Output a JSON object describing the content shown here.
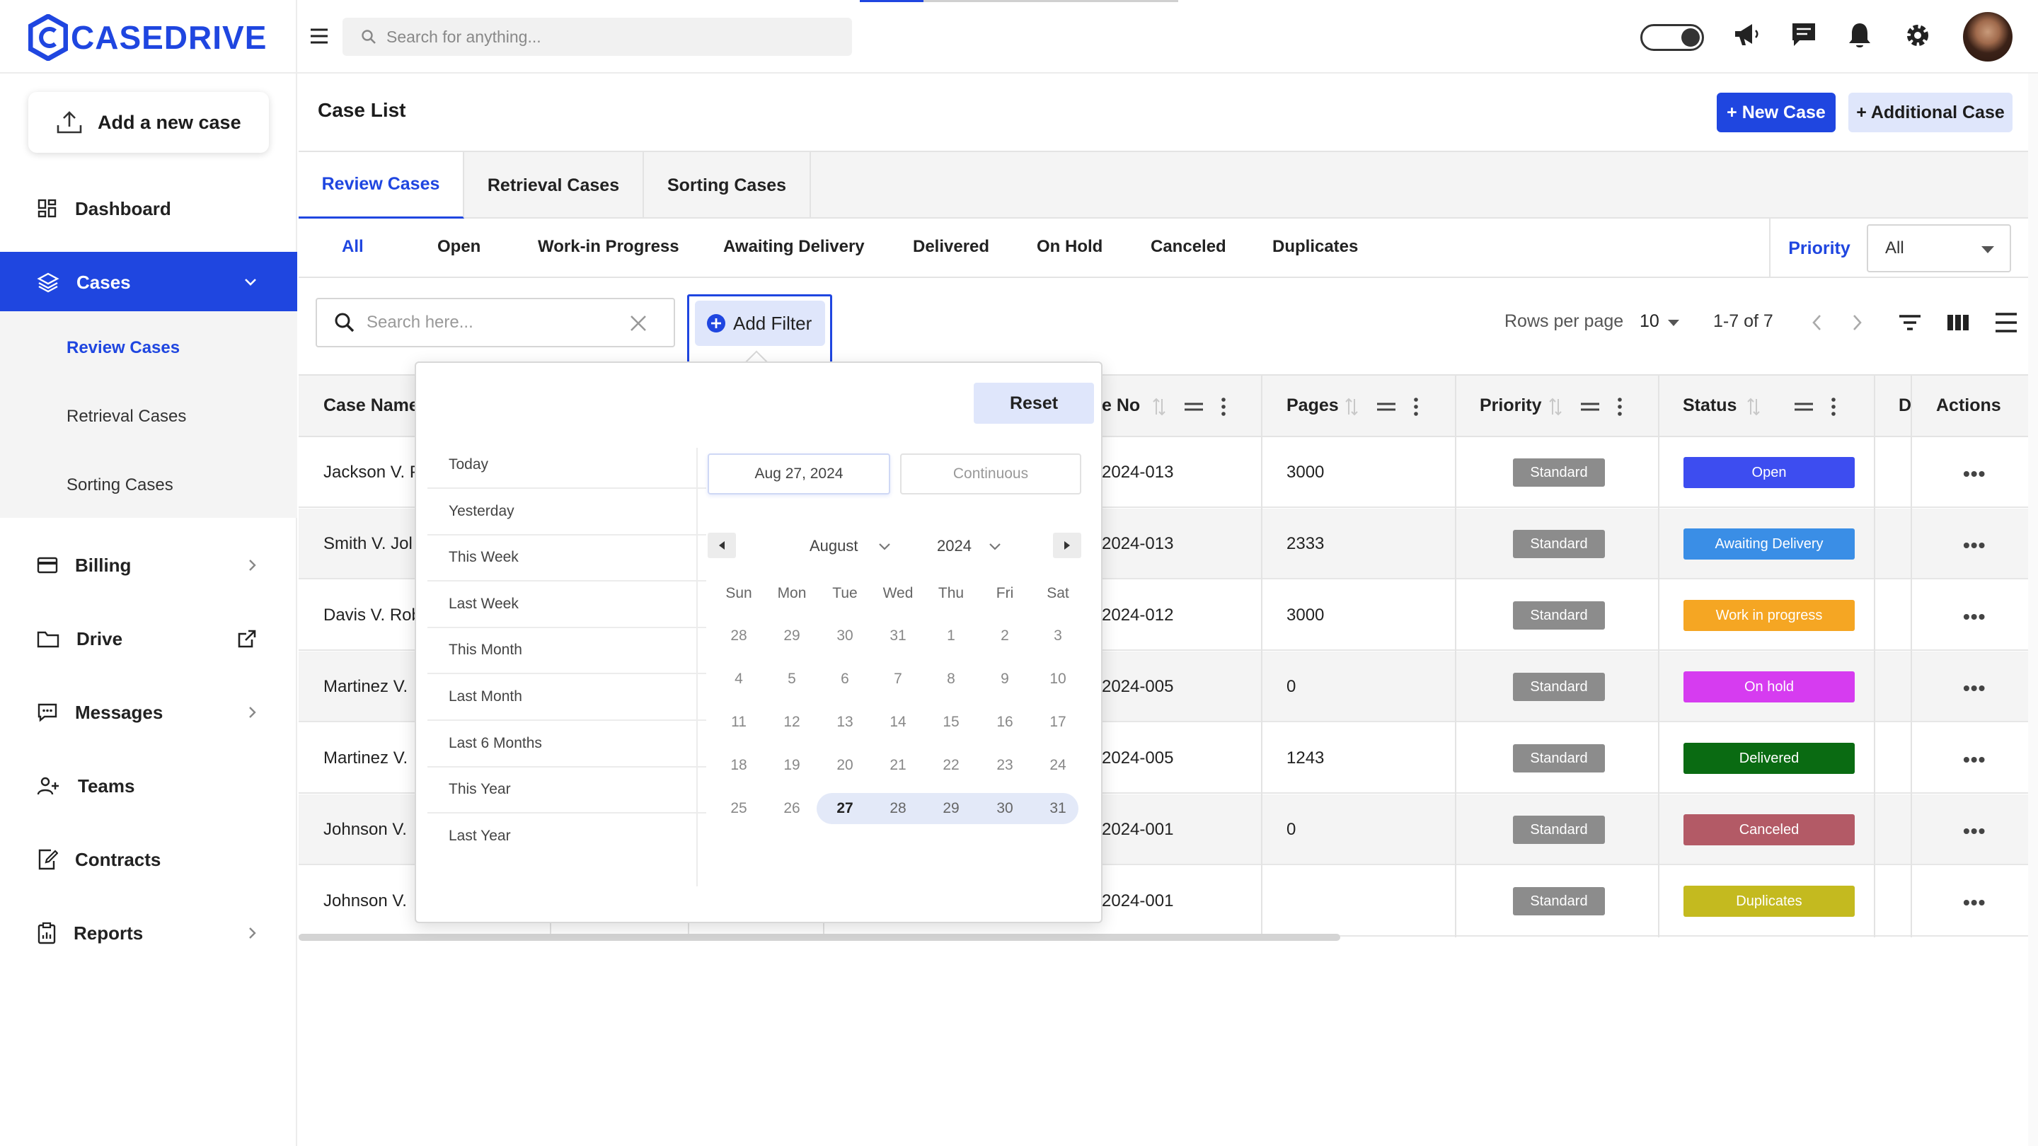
{
  "app": {
    "brand": "CASEDRIVE",
    "brand_color": "#1f46e0"
  },
  "topbar": {
    "search_placeholder": "Search for anything...",
    "icons": [
      "menu-icon",
      "theme-toggle",
      "megaphone-icon",
      "chat-icon",
      "bell-icon",
      "gear-icon",
      "avatar"
    ]
  },
  "sidebar": {
    "add_case_label": "Add a new case",
    "items": [
      {
        "label": "Dashboard",
        "icon": "dashboard-icon"
      },
      {
        "label": "Cases",
        "icon": "layers-icon",
        "active": true
      },
      {
        "label": "Billing",
        "icon": "card-icon"
      },
      {
        "label": "Drive",
        "icon": "folder-icon"
      },
      {
        "label": "Messages",
        "icon": "message-icon"
      },
      {
        "label": "Teams",
        "icon": "team-icon"
      },
      {
        "label": "Contracts",
        "icon": "contract-icon"
      },
      {
        "label": "Reports",
        "icon": "report-icon"
      }
    ],
    "subitems": [
      {
        "label": "Review Cases",
        "active": true
      },
      {
        "label": "Retrieval Cases"
      },
      {
        "label": "Sorting Cases"
      }
    ]
  },
  "page": {
    "title": "Case List",
    "new_case_label": "+ New Case",
    "additional_case_label": "+ Additional Case"
  },
  "tabs": [
    "Review Cases",
    "Retrieval Cases",
    "Sorting Cases"
  ],
  "status_filters": [
    "All",
    "Open",
    "Work-in Progress",
    "Awaiting Delivery",
    "Delivered",
    "On Hold",
    "Canceled",
    "Duplicates"
  ],
  "priority_filter": {
    "label": "Priority",
    "value": "All"
  },
  "toolbar": {
    "search_placeholder": "Search here...",
    "add_filter_label": "Add Filter",
    "rows_per_page_label": "Rows per page",
    "rows_per_page_value": "10",
    "page_info": "1-7 of 7"
  },
  "table": {
    "headers": {
      "case_name": "Case Name",
      "case_no": "e No",
      "pages": "Pages",
      "priority": "Priority",
      "status": "Status",
      "d": "D",
      "actions": "Actions"
    },
    "rows": [
      {
        "name": "Jackson V. P",
        "case_no": "2024-013",
        "pages": "3000",
        "priority": "Standard",
        "status": "Open",
        "status_color": "#3d4df0"
      },
      {
        "name": "Smith V. Jol",
        "case_no": "2024-013",
        "pages": "2333",
        "priority": "Standard",
        "status": "Awaiting Delivery",
        "status_color": "#3a8ee6"
      },
      {
        "name": "Davis V. Rob",
        "case_no": "2024-012",
        "pages": "3000",
        "priority": "Standard",
        "status": "Work in progress",
        "status_color": "#f5a623"
      },
      {
        "name": "Martinez V.",
        "case_no": "2024-005",
        "pages": "0",
        "priority": "Standard",
        "status": "On hold",
        "status_color": "#d63cf0"
      },
      {
        "name": "Martinez V.",
        "case_no": "2024-005",
        "pages": "1243",
        "priority": "Standard",
        "status": "Delivered",
        "status_color": "#0a6b12"
      },
      {
        "name": "Johnson V.",
        "case_no": "2024-001",
        "pages": "0",
        "priority": "Standard",
        "status": "Canceled",
        "status_color": "#b35a66"
      },
      {
        "name": "Johnson V.",
        "case_no": "2024-001",
        "pages": "",
        "priority": "Standard",
        "status": "Duplicates",
        "status_color": "#c4ba1f"
      }
    ]
  },
  "date_filter": {
    "reset_label": "Reset",
    "presets": [
      "Today",
      "Yesterday",
      "This Week",
      "Last Week",
      "This Month",
      "Last Month",
      "Last 6 Months",
      "This Year",
      "Last Year"
    ],
    "start_date": "Aug 27, 2024",
    "end_placeholder": "Continuous",
    "month": "August",
    "year": "2024",
    "weekdays": [
      "Sun",
      "Mon",
      "Tue",
      "Wed",
      "Thu",
      "Fri",
      "Sat"
    ],
    "weeks": [
      [
        "28",
        "29",
        "30",
        "31",
        "1",
        "2",
        "3"
      ],
      [
        "4",
        "5",
        "6",
        "7",
        "8",
        "9",
        "10"
      ],
      [
        "11",
        "12",
        "13",
        "14",
        "15",
        "16",
        "17"
      ],
      [
        "18",
        "19",
        "20",
        "21",
        "22",
        "23",
        "24"
      ],
      [
        "25",
        "26",
        "27",
        "28",
        "29",
        "30",
        "31"
      ]
    ],
    "selected_day": "27"
  }
}
